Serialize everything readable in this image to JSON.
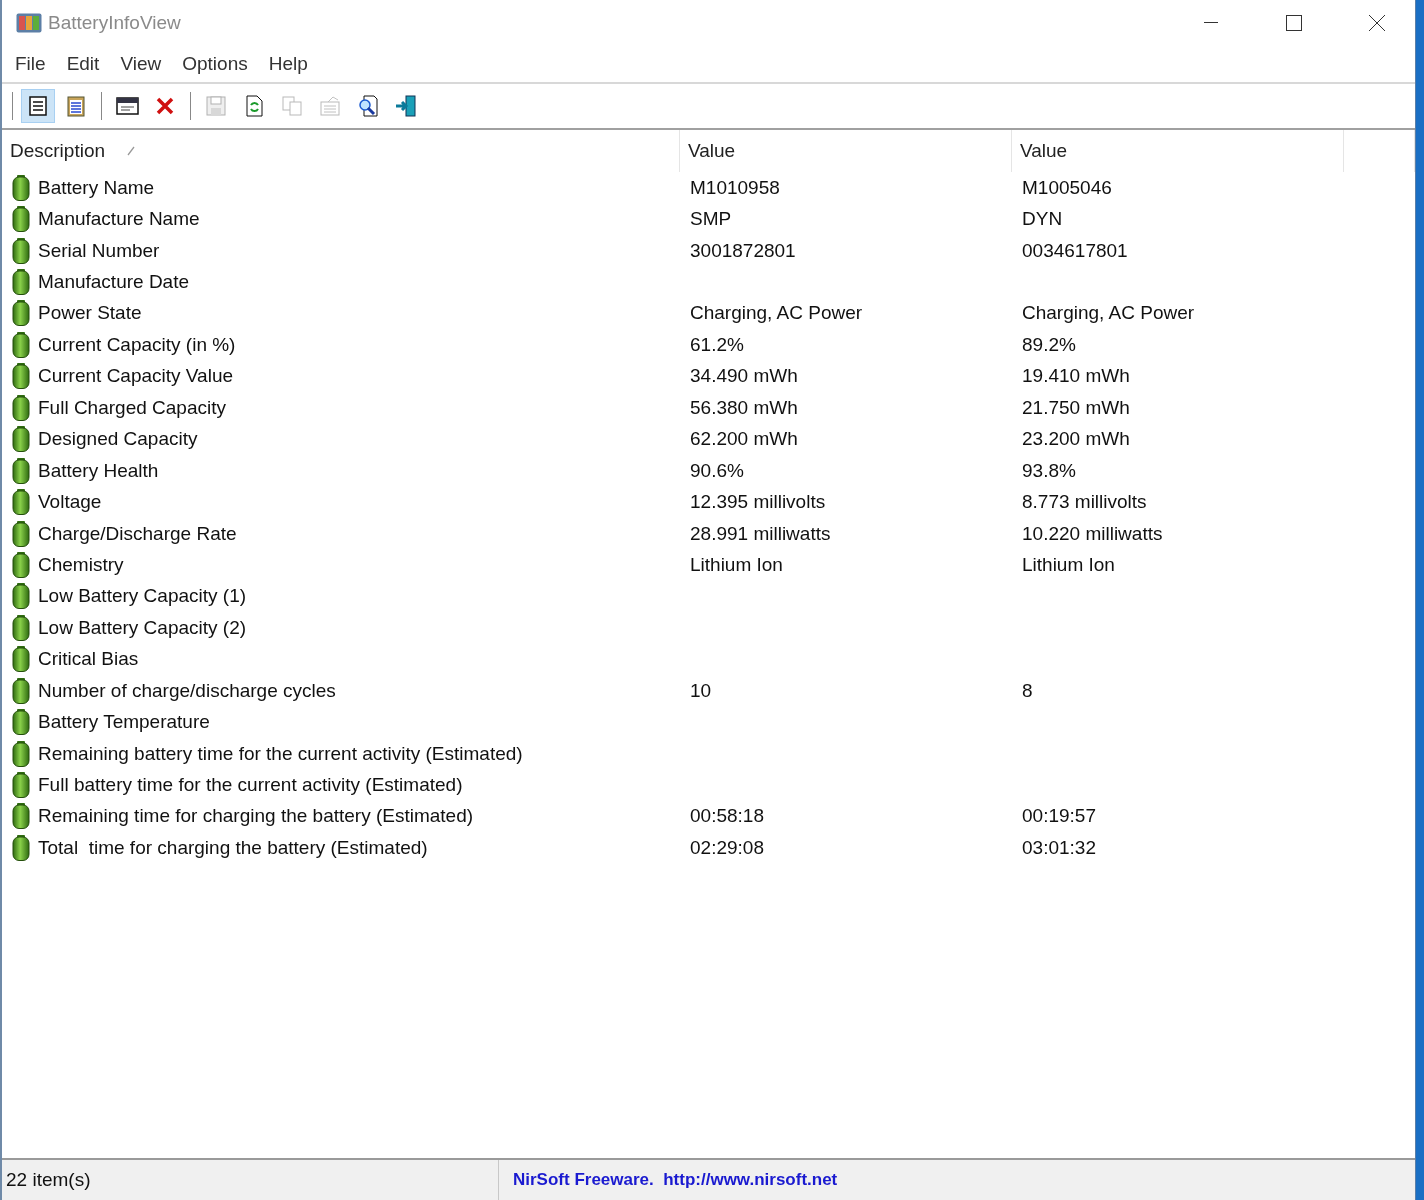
{
  "window": {
    "title": "BatteryInfoView"
  },
  "menu": [
    "File",
    "Edit",
    "View",
    "Options",
    "Help"
  ],
  "toolbar": [
    [
      {
        "kind": "view-list",
        "selected": true,
        "disabled": false
      },
      {
        "kind": "clipboard",
        "selected": false,
        "disabled": false
      }
    ],
    [
      {
        "kind": "window",
        "selected": false,
        "disabled": false
      },
      {
        "kind": "delete",
        "selected": false,
        "disabled": false
      }
    ],
    [
      {
        "kind": "save",
        "selected": false,
        "disabled": true
      },
      {
        "kind": "refresh",
        "selected": false,
        "disabled": false
      },
      {
        "kind": "copy",
        "selected": false,
        "disabled": true
      },
      {
        "kind": "properties",
        "selected": false,
        "disabled": true
      },
      {
        "kind": "find",
        "selected": false,
        "disabled": false
      },
      {
        "kind": "exit",
        "selected": false,
        "disabled": false
      }
    ]
  ],
  "table": {
    "columns": [
      {
        "label": "Description",
        "sorted": true
      },
      {
        "label": "Value",
        "sorted": false
      },
      {
        "label": "Value",
        "sorted": false
      }
    ],
    "rows": [
      {
        "description": "Battery Name",
        "value_1": "M1010958",
        "value_2": "M1005046"
      },
      {
        "description": "Manufacture Name",
        "value_1": "SMP",
        "value_2": "DYN"
      },
      {
        "description": "Serial Number",
        "value_1": "3001872801",
        "value_2": "0034617801"
      },
      {
        "description": "Manufacture Date"
      },
      {
        "description": "Power State",
        "value_1": "Charging, AC Power",
        "value_2": "Charging, AC Power"
      },
      {
        "description": "Current Capacity (in %)",
        "value_1": "61.2%",
        "value_2": "89.2%"
      },
      {
        "description": "Current Capacity Value",
        "value_1": "34.490 mWh",
        "value_2": "19.410 mWh"
      },
      {
        "description": "Full Charged Capacity",
        "value_1": "56.380 mWh",
        "value_2": "21.750 mWh"
      },
      {
        "description": "Designed Capacity",
        "value_1": "62.200 mWh",
        "value_2": "23.200 mWh"
      },
      {
        "description": "Battery Health",
        "value_1": "90.6%",
        "value_2": "93.8%"
      },
      {
        "description": "Voltage",
        "value_1": "12.395 millivolts",
        "value_2": "8.773 millivolts"
      },
      {
        "description": "Charge/Discharge Rate",
        "value_1": "28.991 milliwatts",
        "value_2": "10.220 milliwatts"
      },
      {
        "description": "Chemistry",
        "value_1": "Lithium Ion",
        "value_2": "Lithium Ion"
      },
      {
        "description": "Low Battery Capacity (1)"
      },
      {
        "description": "Low Battery Capacity (2)"
      },
      {
        "description": "Critical Bias"
      },
      {
        "description": "Number of charge/discharge cycles",
        "value_1": "10",
        "value_2": "8"
      },
      {
        "description": "Battery Temperature"
      },
      {
        "description": "Remaining battery time for the current activity (Estimated)"
      },
      {
        "description": "Full battery time for the current activity (Estimated)"
      },
      {
        "description": "Remaining time for charging the battery (Estimated)",
        "value_1": "00:58:18",
        "value_2": "00:19:57"
      },
      {
        "description": "Total  time for charging the battery (Estimated)",
        "value_1": "02:29:08",
        "value_2": "03:01:32"
      }
    ]
  },
  "status_bar": {
    "count": "22 item(s)",
    "credit": "NirSoft Freeware.  http://www.nirsoft.net"
  }
}
